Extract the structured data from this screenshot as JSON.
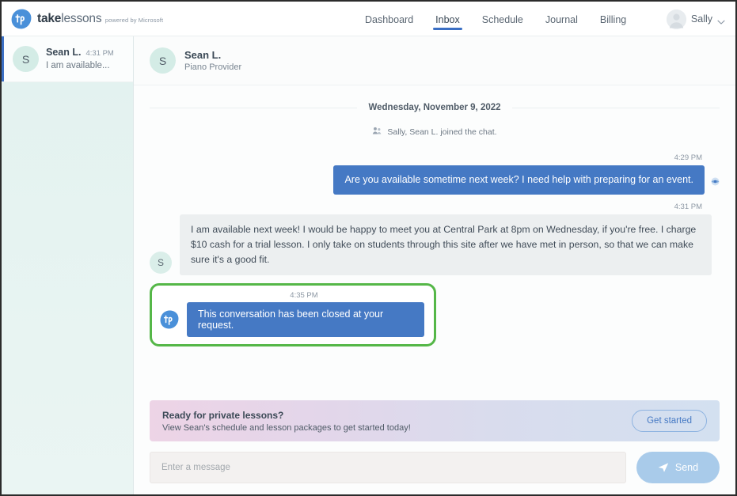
{
  "brand": {
    "name_bold": "take",
    "name_light": "lessons",
    "tagline": "powered by Microsoft",
    "logo_icon": "takelessons-leaf-logo-icon"
  },
  "nav": {
    "links": [
      {
        "label": "Dashboard",
        "active": false
      },
      {
        "label": "Inbox",
        "active": true
      },
      {
        "label": "Schedule",
        "active": false
      },
      {
        "label": "Journal",
        "active": false
      },
      {
        "label": "Billing",
        "active": false
      }
    ],
    "user": {
      "name": "Sally",
      "avatar_icon": "user-avatar-icon",
      "chevron_icon": "chevron-down-icon"
    }
  },
  "sidebar": {
    "conversations": [
      {
        "avatar_initial": "S",
        "name": "Sean L.",
        "time": "4:31 PM",
        "preview": "I am available...",
        "active": true
      }
    ]
  },
  "chat_header": {
    "avatar_initial": "S",
    "name": "Sean L.",
    "role": "Piano Provider"
  },
  "thread": {
    "date_divider": "Wednesday, November 9, 2022",
    "system_message": {
      "icon": "people-group-icon",
      "text": "Sally, Sean L. joined the chat."
    },
    "messages": [
      {
        "direction": "outgoing",
        "time": "4:29 PM",
        "text": "Are you available sometime next week? I need help with preparing for an event.",
        "read_icon": "message-read-icon"
      },
      {
        "direction": "incoming",
        "time": "4:31 PM",
        "avatar_initial": "S",
        "text": "I am available next week! I would be happy to meet you at Central Park at 8pm on Wednesday, if you're free. I charge $10 cash for a trial lesson. I only take on students through this site after we have met in person, so that we can make sure it's a good fit."
      },
      {
        "direction": "system-notice",
        "time": "4:35 PM",
        "logo_icon": "takelessons-leaf-logo-icon",
        "text": "This conversation has been closed at your request.",
        "highlighted": true,
        "highlight_color": "#55b748"
      }
    ]
  },
  "promo": {
    "title": "Ready for private lessons?",
    "subtitle": "View Sean's schedule and lesson packages to get started today!",
    "button_label": "Get started"
  },
  "composer": {
    "placeholder": "Enter a message",
    "value": "",
    "send_label": "Send",
    "send_icon": "paper-plane-icon"
  },
  "colors": {
    "accent_blue": "#4579c4",
    "highlight_green": "#55b748",
    "sidebar_mint": "#e4f2f0",
    "bubble_in_gray": "#eceff0"
  }
}
